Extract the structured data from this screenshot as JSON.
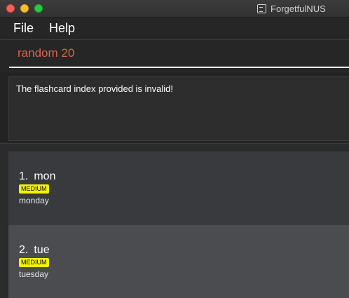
{
  "window": {
    "title": "ForgetfulNUS",
    "icon": "app-icon",
    "controls": [
      "close-icon",
      "minimize-icon",
      "maximize-icon"
    ]
  },
  "menu": {
    "file_label": "File",
    "help_label": "Help"
  },
  "command": {
    "value": "random 20"
  },
  "result": {
    "message": "The flashcard index provided is invalid!"
  },
  "flashcards": [
    {
      "index": "1.",
      "front": "mon",
      "difficulty": "MEDIUM",
      "back": "monday"
    },
    {
      "index": "2.",
      "front": "tue",
      "difficulty": "MEDIUM",
      "back": "tuesday"
    }
  ],
  "colors": {
    "command_text": "#d6644c",
    "badge_background": "#f4f400",
    "card_odd": "#393a3d",
    "card_even": "#4a4c4f"
  }
}
